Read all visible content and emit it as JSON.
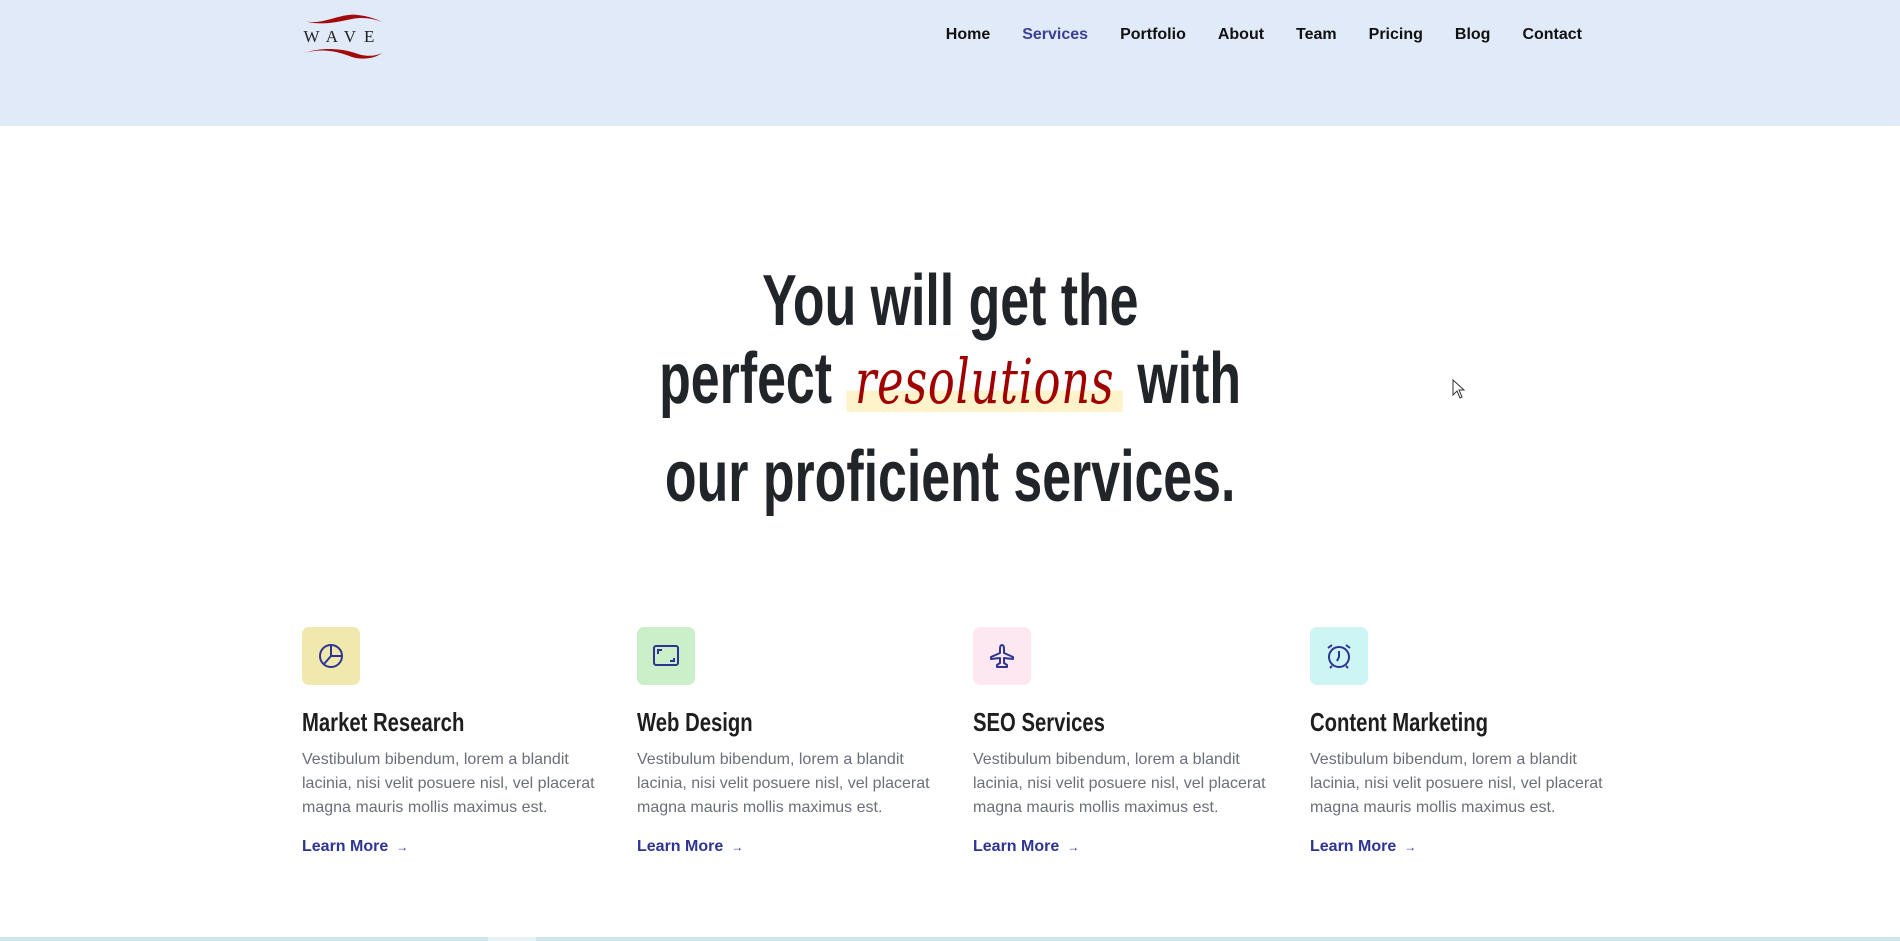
{
  "header": {
    "logo_text": "WAVE",
    "nav": [
      "Home",
      "Services",
      "Portfolio",
      "About",
      "Team",
      "Pricing",
      "Blog",
      "Contact"
    ],
    "active": "Services"
  },
  "hero": {
    "line1": "You will get the",
    "line2_pre": "perfect",
    "highlight": "resolutions",
    "line2_post": "with",
    "line3": "our proficient services."
  },
  "services": [
    {
      "title": "Market Research",
      "text": "Vestibulum bibendum, lorem a blandit lacinia, nisi velit posuere nisl, vel placerat magna mauris mollis maximus est.",
      "link": "Learn More",
      "icon": "pie-chart-icon",
      "color": "#f1e8ad"
    },
    {
      "title": "Web Design",
      "text": "Vestibulum bibendum, lorem a blandit lacinia, nisi velit posuere nisl, vel placerat magna mauris mollis maximus est.",
      "link": "Learn More",
      "icon": "frame-icon",
      "color": "#cbf0c9"
    },
    {
      "title": "SEO Services",
      "text": "Vestibulum bibendum, lorem a blandit lacinia, nisi velit posuere nisl, vel placerat magna mauris mollis maximus est.",
      "link": "Learn More",
      "icon": "airplane-icon",
      "color": "#fde8f1"
    },
    {
      "title": "Content Marketing",
      "text": "Vestibulum bibendum, lorem a blandit lacinia, nisi velit posuere nisl, vel placerat magna mauris mollis maximus est.",
      "link": "Learn More",
      "icon": "alarm-clock-icon",
      "color": "#ccf5f4"
    }
  ],
  "colors": {
    "accent": "#2d3494",
    "script": "#a00000",
    "header_bg": "#e0eaf8"
  }
}
